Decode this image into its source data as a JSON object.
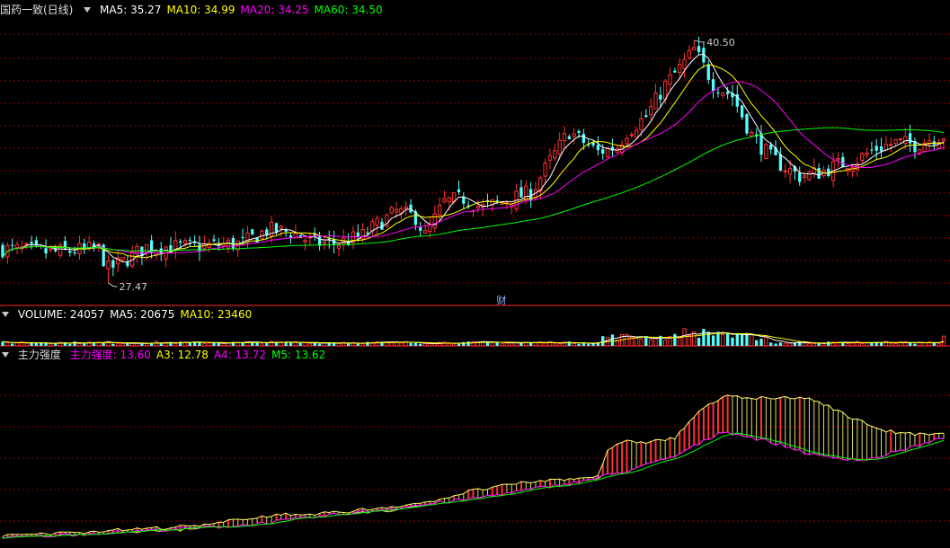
{
  "panels": {
    "price": {
      "title": "国药一致(日线)",
      "ma_items": [
        {
          "label": "MA5: 35.27",
          "color": "#ffffff"
        },
        {
          "label": "MA10: 34.99",
          "color": "#ffff00"
        },
        {
          "label": "MA20: 34.25",
          "color": "#ff00ff"
        },
        {
          "label": "MA60: 34.50",
          "color": "#00ff00"
        }
      ],
      "high_label": "40.50",
      "low_label": "27.47",
      "event_marker": "财"
    },
    "volume": {
      "items": [
        {
          "label": "VOLUME: 24057",
          "color": "#ffffff"
        },
        {
          "label": "MA5: 20675",
          "color": "#ffffff"
        },
        {
          "label": "MA10: 23460",
          "color": "#ffff00"
        }
      ]
    },
    "indicator": {
      "title": "主力强度",
      "items": [
        {
          "label": "主力强度: 13.60",
          "color": "#ff00ff"
        },
        {
          "label": "A3: 12.78",
          "color": "#ffff00"
        },
        {
          "label": "A4: 13.72",
          "color": "#ff00ff"
        },
        {
          "label": "M5: 13.62",
          "color": "#00ff00"
        }
      ]
    }
  },
  "colors": {
    "up": "#ff3232",
    "down": "#54ffff",
    "ma5": "#ffffff",
    "ma10": "#ffff00",
    "ma20": "#ff00ff",
    "ma60": "#00ff00",
    "grid": "#8b0000",
    "separator": "#b01818"
  },
  "chart_data": [
    {
      "type": "candlestick",
      "title": "国药一致(日线)",
      "ylim": [
        26.5,
        41.8
      ],
      "high": 40.5,
      "low": 27.47,
      "anchors": [
        [
          0,
          29.3
        ],
        [
          10,
          29.1
        ],
        [
          20,
          29.3
        ],
        [
          22,
          28.2
        ],
        [
          25,
          28.6
        ],
        [
          30,
          29.4
        ],
        [
          40,
          29.4
        ],
        [
          50,
          29.6
        ],
        [
          55,
          30.3
        ],
        [
          60,
          30.2
        ],
        [
          65,
          29.6
        ],
        [
          70,
          29.6
        ],
        [
          75,
          30.0
        ],
        [
          78,
          30.6
        ],
        [
          82,
          31.3
        ],
        [
          86,
          31.0
        ],
        [
          88,
          30.0
        ],
        [
          92,
          31.8
        ],
        [
          96,
          32.0
        ],
        [
          100,
          31.5
        ],
        [
          106,
          32.0
        ],
        [
          110,
          32.3
        ],
        [
          114,
          34.0
        ],
        [
          118,
          35.6
        ],
        [
          120,
          35.2
        ],
        [
          124,
          34.5
        ],
        [
          128,
          34.8
        ],
        [
          130,
          35.6
        ],
        [
          134,
          36.4
        ],
        [
          138,
          38.1
        ],
        [
          142,
          39.3
        ],
        [
          144,
          40.0
        ],
        [
          148,
          38.2
        ],
        [
          152,
          37.5
        ],
        [
          156,
          35.4
        ],
        [
          160,
          34.2
        ],
        [
          164,
          33.5
        ],
        [
          166,
          33.2
        ],
        [
          170,
          33.4
        ],
        [
          174,
          33.8
        ],
        [
          178,
          34.1
        ],
        [
          182,
          34.7
        ],
        [
          186,
          35.0
        ],
        [
          190,
          34.9
        ],
        [
          194,
          35.3
        ],
        [
          196,
          35.4
        ]
      ],
      "series_ma": [
        "MA5",
        "MA10",
        "MA20",
        "MA60"
      ]
    },
    {
      "type": "bar",
      "title": "VOLUME",
      "ylim": [
        0,
        60000
      ],
      "last": 24057
    },
    {
      "type": "area",
      "title": "主力强度",
      "ylim": [
        0,
        100
      ],
      "anchors": [
        [
          0,
          4
        ],
        [
          20,
          6
        ],
        [
          40,
          8
        ],
        [
          50,
          14
        ],
        [
          60,
          16
        ],
        [
          70,
          17
        ],
        [
          82,
          18
        ],
        [
          88,
          22
        ],
        [
          96,
          28
        ],
        [
          100,
          30
        ],
        [
          110,
          34
        ],
        [
          120,
          36
        ],
        [
          124,
          36
        ],
        [
          126,
          52
        ],
        [
          130,
          56
        ],
        [
          134,
          56
        ],
        [
          140,
          58
        ],
        [
          144,
          70
        ],
        [
          148,
          78
        ],
        [
          150,
          80
        ],
        [
          152,
          82
        ],
        [
          156,
          80
        ],
        [
          160,
          80
        ],
        [
          164,
          80
        ],
        [
          168,
          80
        ],
        [
          172,
          76
        ],
        [
          176,
          70
        ],
        [
          180,
          66
        ],
        [
          184,
          62
        ],
        [
          190,
          60
        ],
        [
          196,
          60
        ]
      ],
      "m5_anchors": [
        [
          0,
          3
        ],
        [
          50,
          10
        ],
        [
          96,
          24
        ],
        [
          120,
          34
        ],
        [
          130,
          40
        ],
        [
          140,
          48
        ],
        [
          150,
          62
        ],
        [
          160,
          56
        ],
        [
          170,
          48
        ],
        [
          180,
          46
        ],
        [
          196,
          58
        ]
      ]
    }
  ]
}
